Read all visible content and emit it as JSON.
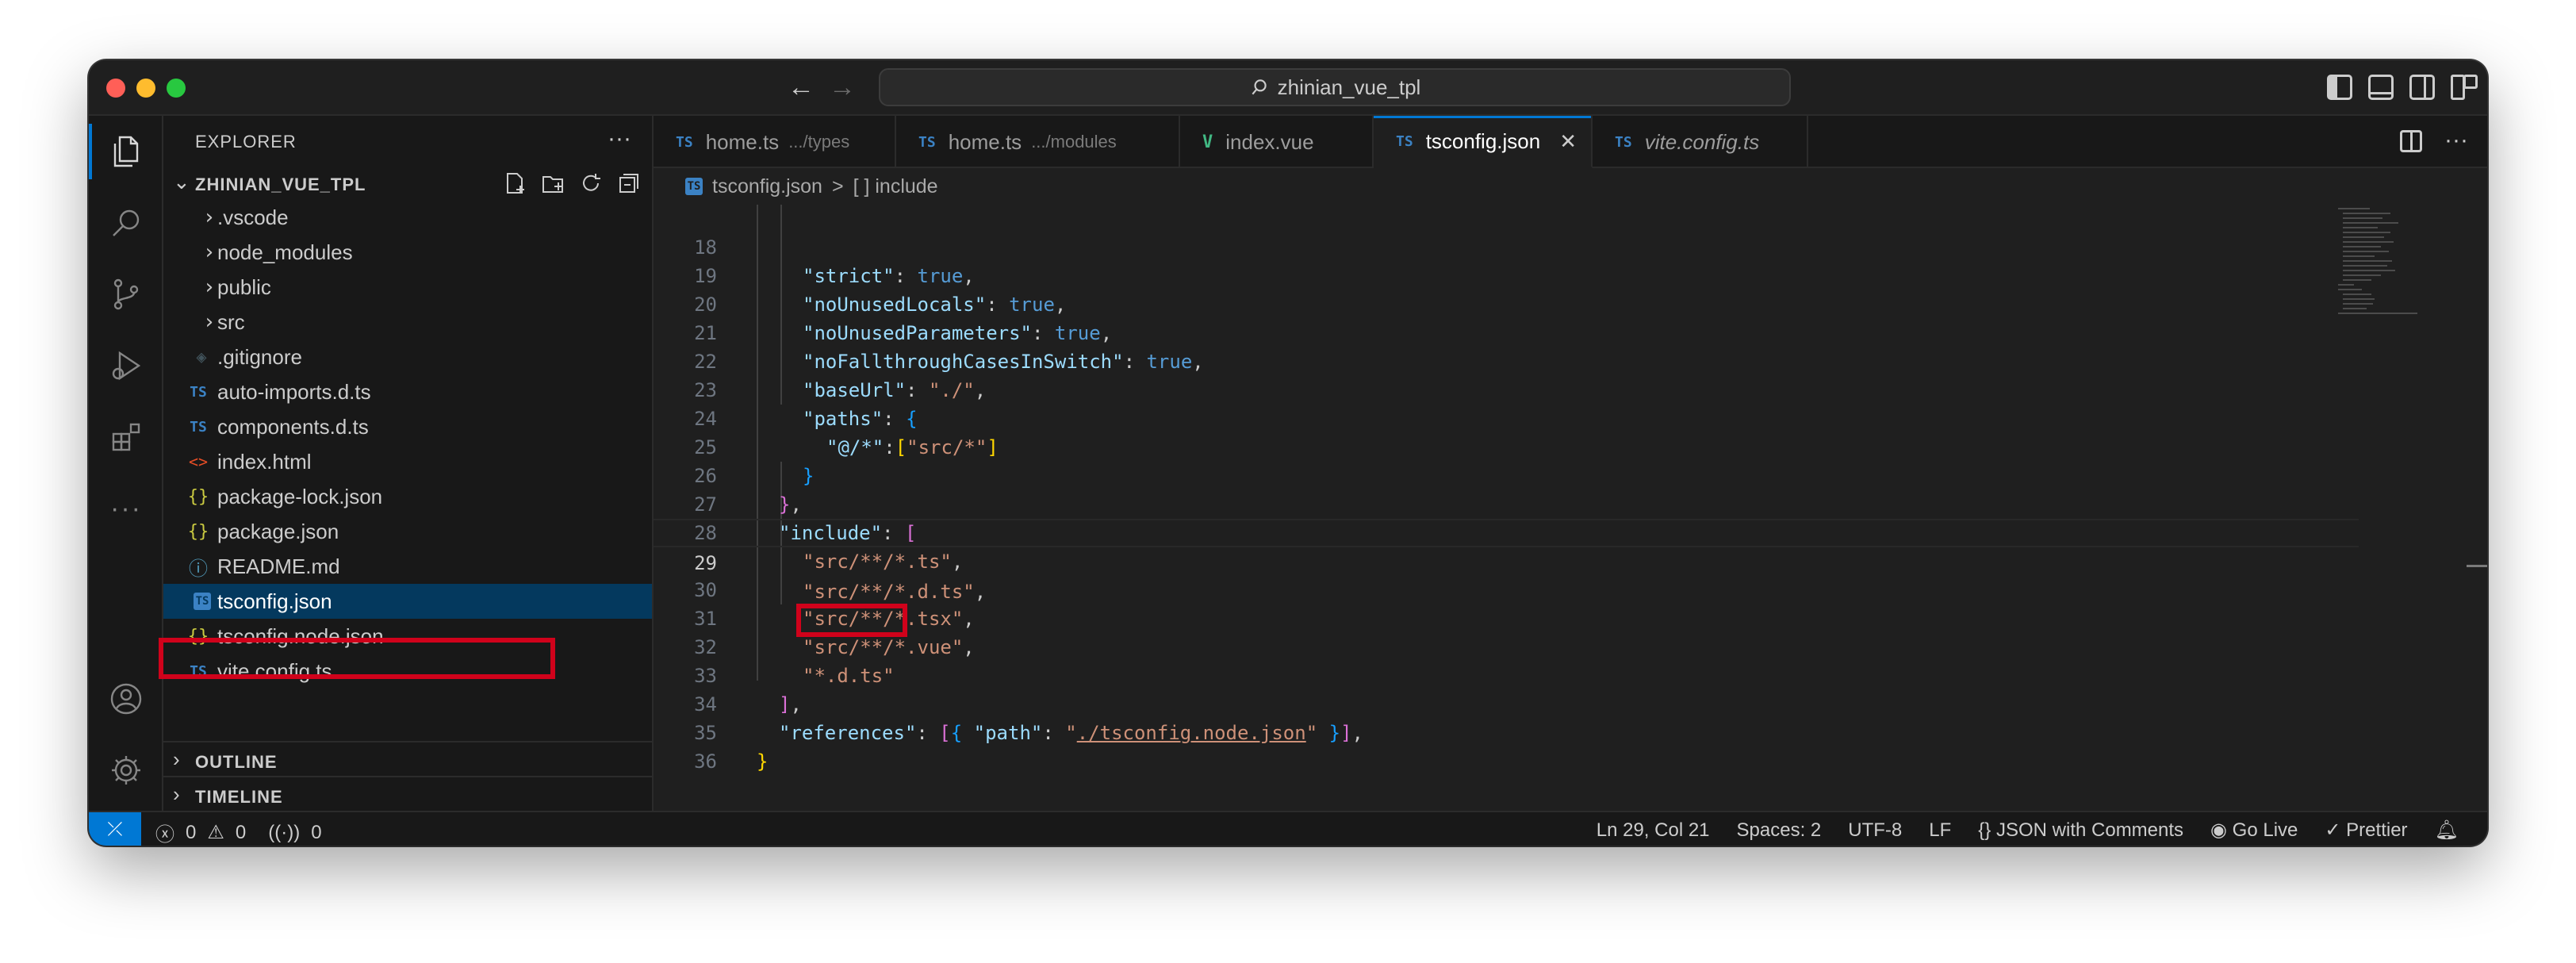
{
  "titlebar": {
    "search_text": "zhinian_vue_tpl"
  },
  "sidebar": {
    "title": "EXPLORER",
    "more": "···",
    "folder_name": "ZHINIAN_VUE_TPL",
    "items": [
      {
        "label": ".vscode",
        "icon": "chevron-right-icon",
        "type": "folder"
      },
      {
        "label": "node_modules",
        "icon": "chevron-right-icon",
        "type": "folder"
      },
      {
        "label": "public",
        "icon": "chevron-right-icon",
        "type": "folder"
      },
      {
        "label": "src",
        "icon": "chevron-right-icon",
        "type": "folder"
      },
      {
        "label": ".gitignore",
        "icon": "git-icon",
        "type": "file"
      },
      {
        "label": "auto-imports.d.ts",
        "icon": "ts-icon",
        "badge": "TS",
        "type": "file"
      },
      {
        "label": "components.d.ts",
        "icon": "ts-icon",
        "badge": "TS",
        "type": "file"
      },
      {
        "label": "index.html",
        "icon": "html-icon",
        "type": "file"
      },
      {
        "label": "package-lock.json",
        "icon": "json-icon",
        "badge": "{}",
        "type": "file"
      },
      {
        "label": "package.json",
        "icon": "json-icon",
        "badge": "{}",
        "type": "file"
      },
      {
        "label": "README.md",
        "icon": "info-icon",
        "type": "file"
      },
      {
        "label": "tsconfig.json",
        "icon": "tsconfig-icon",
        "badge": "TS",
        "type": "file",
        "selected": true
      },
      {
        "label": "tsconfig.node.json",
        "icon": "json-icon",
        "badge": "{}",
        "type": "file"
      },
      {
        "label": "vite.config.ts",
        "icon": "ts-icon",
        "badge": "TS",
        "type": "file"
      }
    ],
    "sections": [
      "OUTLINE",
      "TIMELINE"
    ]
  },
  "tabs": [
    {
      "label": "home.ts",
      "desc": ".../types",
      "badge": "TS"
    },
    {
      "label": "home.ts",
      "desc": ".../modules",
      "badge": "TS"
    },
    {
      "label": "index.vue",
      "desc": "",
      "badge": "V"
    },
    {
      "label": "tsconfig.json",
      "desc": "",
      "badge": "TS",
      "active": true
    },
    {
      "label": "vite.config.ts",
      "desc": "",
      "badge": "TS"
    }
  ],
  "breadcrumb": {
    "file": "tsconfig.json",
    "separator": ">",
    "symbol": "[ ] include"
  },
  "code": {
    "current_line": 29,
    "lines": [
      {
        "n": "18"
      },
      {
        "n": "19"
      },
      {
        "n": "20"
      },
      {
        "n": "21"
      },
      {
        "n": "22"
      },
      {
        "n": "23"
      },
      {
        "n": "24"
      },
      {
        "n": "25"
      },
      {
        "n": "26"
      },
      {
        "n": "27"
      },
      {
        "n": "28"
      },
      {
        "n": "29"
      },
      {
        "n": "30"
      },
      {
        "n": "31"
      },
      {
        "n": "32"
      },
      {
        "n": "33"
      },
      {
        "n": "34"
      },
      {
        "n": "35"
      },
      {
        "n": "36"
      }
    ],
    "text": {
      "l18_key": "\"strict\"",
      "l18_val": "true",
      "l19_key": "\"noUnusedLocals\"",
      "l19_val": "true",
      "l20_key": "\"noUnusedParameters\"",
      "l20_val": "true",
      "l21_key": "\"noFallthroughCasesInSwitch\"",
      "l21_val": "true",
      "l22_key": "\"baseUrl\"",
      "l22_val": "\"./\"",
      "l23_key": "\"paths\"",
      "l24_key": "\"@/*\"",
      "l24_val": "\"src/*\"",
      "l27_key": "\"include\"",
      "l28_val": "\"src/**/*.ts\"",
      "l29_val": "\"src/**/*.d.ts\"",
      "l30_val": "\"src/**/*.tsx\"",
      "l31_val": "\"src/**/*.vue\"",
      "l32_val": "\"*.d.ts\"",
      "l34_key": "\"references\"",
      "l34_path_key": "\"path\"",
      "l34_path_val": "./tsconfig.node.json"
    }
  },
  "statusbar": {
    "errors": "0",
    "warnings": "0",
    "ports": "0",
    "position": "Ln 29, Col 21",
    "spaces": "Spaces: 2",
    "encoding": "UTF-8",
    "eol": "LF",
    "language": "JSON with Comments",
    "golive": "Go Live",
    "prettier": "Prettier"
  },
  "colors": {
    "accent": "#0078d4",
    "highlight_box": "#d0021b",
    "selection": "#04395e"
  }
}
